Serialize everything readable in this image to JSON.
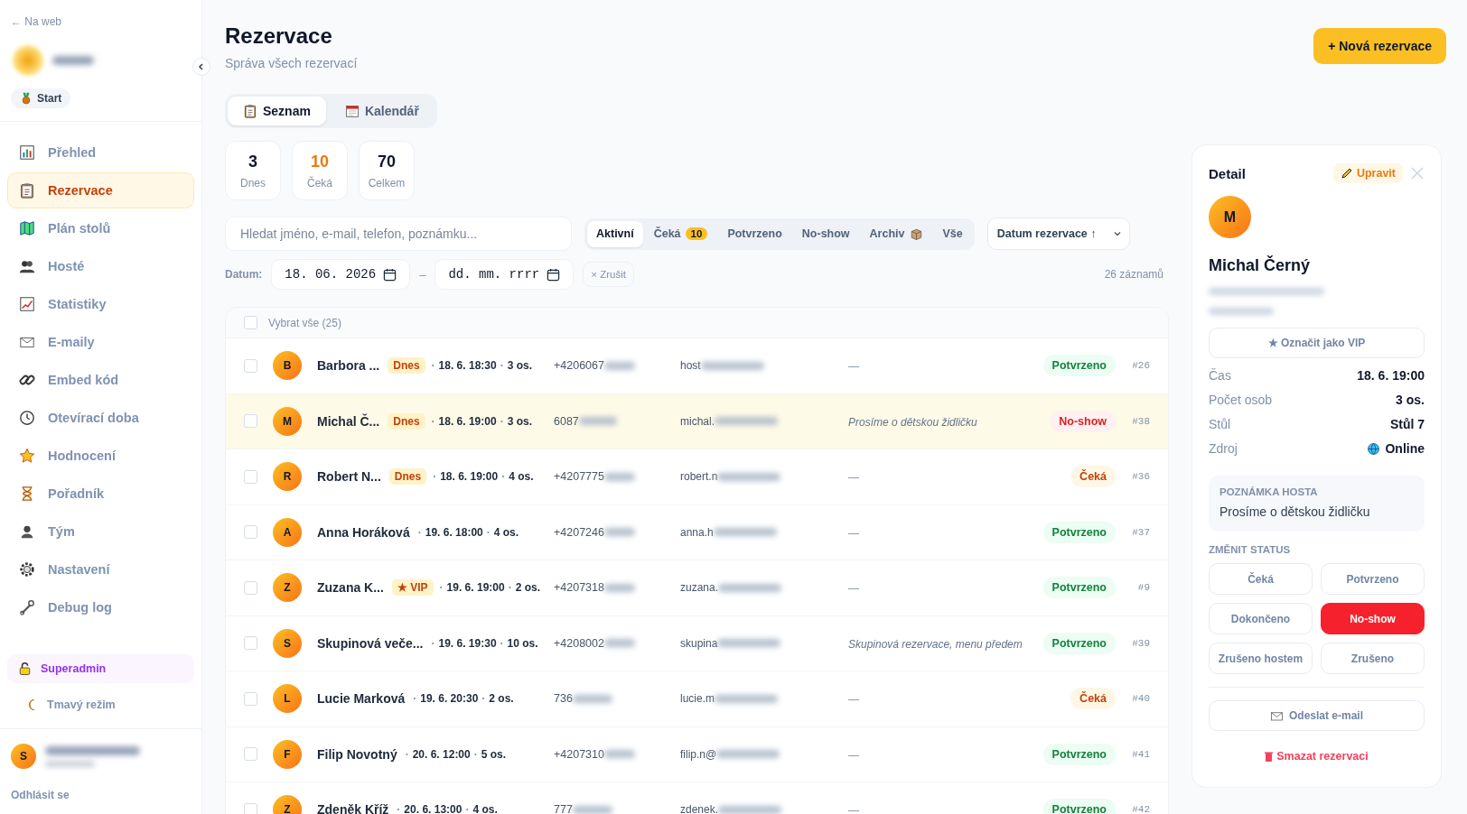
{
  "sidebar": {
    "back_link": "← Na web",
    "start_badge": "Start",
    "nav": [
      {
        "label": "Přehled",
        "selected": false
      },
      {
        "label": "Rezervace",
        "selected": true
      },
      {
        "label": "Plán stolů",
        "selected": false
      },
      {
        "label": "Hosté",
        "selected": false
      },
      {
        "label": "Statistiky",
        "selected": false
      },
      {
        "label": "E-maily",
        "selected": false
      },
      {
        "label": "Embed kód",
        "selected": false
      },
      {
        "label": "Otevírací doba",
        "selected": false
      },
      {
        "label": "Hodnocení",
        "selected": false
      },
      {
        "label": "Pořadník",
        "selected": false
      },
      {
        "label": "Tým",
        "selected": false
      },
      {
        "label": "Nastavení",
        "selected": false
      },
      {
        "label": "Debug log",
        "selected": false
      }
    ],
    "superadmin": "Superadmin",
    "dark_mode": "Tmavý režim",
    "user_initial": "S",
    "logout": "Odhlásit se"
  },
  "page": {
    "title": "Rezervace",
    "subtitle": "Správa všech rezervací",
    "new_button": "+ Nová rezervace"
  },
  "view_tabs": [
    {
      "label": "Seznam",
      "selected": true
    },
    {
      "label": "Kalendář",
      "selected": false
    }
  ],
  "stats": [
    {
      "value": "3",
      "label": "Dnes",
      "highlight": false
    },
    {
      "value": "10",
      "label": "Čeká",
      "highlight": true
    },
    {
      "value": "70",
      "label": "Celkem",
      "highlight": false
    }
  ],
  "search": {
    "placeholder": "Hledat jméno, e-mail, telefon, poznámku..."
  },
  "filters": [
    {
      "label": "Aktivní",
      "selected": true
    },
    {
      "label": "Čeká",
      "count": "10",
      "selected": false
    },
    {
      "label": "Potvrzeno",
      "selected": false
    },
    {
      "label": "No-show",
      "selected": false
    },
    {
      "label": "Archiv",
      "selected": false
    },
    {
      "label": "Vše",
      "selected": false
    }
  ],
  "sort": {
    "label": "Datum rezervace ↑"
  },
  "date_filter": {
    "label": "Datum:",
    "from": "18. 06. 2026",
    "separator": "–",
    "to_placeholder": "dd. mm. rrrr",
    "clear": "× Zrušit"
  },
  "record_count": "26 záznamů",
  "table": {
    "select_all": "Vybrat vše (25)",
    "select_all_checked": false,
    "rows": [
      {
        "checked": false,
        "initial": "B",
        "name": "Barbora ...",
        "tag": "Dnes",
        "sep1": "·",
        "datetime": "18. 6. 18:30",
        "sep2": "·",
        "guests": "3 os.",
        "phone": "+4206067",
        "email": "host",
        "note": "—",
        "status": {
          "kind": "confirmed",
          "label": "Potvrzeno"
        },
        "id": "#26",
        "selected": false
      },
      {
        "checked": false,
        "initial": "M",
        "name": "Michal Č...",
        "tag": "Dnes",
        "sep1": "·",
        "datetime": "18. 6. 19:00",
        "sep2": "·",
        "guests": "3 os.",
        "phone": "6087",
        "email": "michal.",
        "note": "Prosíme o dětskou židličku",
        "status": {
          "kind": "noshow",
          "label": "No-show"
        },
        "id": "#38",
        "selected": true
      },
      {
        "checked": false,
        "initial": "R",
        "name": "Robert N...",
        "tag": "Dnes",
        "sep1": "·",
        "datetime": "18. 6. 19:00",
        "sep2": "·",
        "guests": "4 os.",
        "phone": "+4207775",
        "email": "robert.n",
        "note": "—",
        "status": {
          "kind": "pending",
          "label": "Čeká"
        },
        "id": "#36",
        "selected": false
      },
      {
        "checked": false,
        "initial": "A",
        "name": "Anna Horáková",
        "sep1": "·",
        "datetime": "19. 6. 18:00",
        "sep2": "·",
        "guests": "4 os.",
        "phone": "+4207246",
        "email": "anna.h",
        "note": "—",
        "status": {
          "kind": "confirmed",
          "label": "Potvrzeno"
        },
        "id": "#37",
        "selected": false
      },
      {
        "checked": false,
        "initial": "Z",
        "name": "Zuzana K...",
        "tag": "★ VIP",
        "sep1": "·",
        "datetime": "19. 6. 19:00",
        "sep2": "·",
        "guests": "2 os.",
        "phone": "+4207318",
        "email": "zuzana.",
        "note": "—",
        "status": {
          "kind": "confirmed",
          "label": "Potvrzeno"
        },
        "id": "#9",
        "selected": false
      },
      {
        "checked": false,
        "initial": "S",
        "name": "Skupinová veče...",
        "sep1": "·",
        "datetime": "19. 6. 19:30",
        "sep2": "·",
        "guests": "10 os.",
        "phone": "+4208002",
        "email": "skupina",
        "note": "Skupinová rezervace, menu předem",
        "status": {
          "kind": "confirmed",
          "label": "Potvrzeno"
        },
        "id": "#39",
        "selected": false
      },
      {
        "checked": false,
        "initial": "L",
        "name": "Lucie Marková",
        "sep1": "·",
        "datetime": "19. 6. 20:30",
        "sep2": "·",
        "guests": "2 os.",
        "phone": "736",
        "email": "lucie.m",
        "note": "—",
        "status": {
          "kind": "pending",
          "label": "Čeká"
        },
        "id": "#40",
        "selected": false
      },
      {
        "checked": false,
        "initial": "F",
        "name": "Filip Novotný",
        "sep1": "·",
        "datetime": "20. 6. 12:00",
        "sep2": "·",
        "guests": "5 os.",
        "phone": "+4207310",
        "email": "filip.n@",
        "note": "—",
        "status": {
          "kind": "confirmed",
          "label": "Potvrzeno"
        },
        "id": "#41",
        "selected": false
      },
      {
        "checked": false,
        "initial": "Z",
        "name": "Zdeněk Kříž",
        "sep1": "·",
        "datetime": "20. 6. 13:00",
        "sep2": "·",
        "guests": "4 os.",
        "phone": "777",
        "email": "zdenek.",
        "note": "—",
        "status": {
          "kind": "confirmed",
          "label": "Potvrzeno"
        },
        "id": "#42",
        "selected": false
      }
    ]
  },
  "detail": {
    "title": "Detail",
    "edit_button": "Upravit",
    "initial": "M",
    "name": "Michal Černý",
    "vip_button": "★ Označit jako VIP",
    "fields": [
      {
        "label": "Čas",
        "value": "18. 6. 19:00"
      },
      {
        "label": "Počet osob",
        "value": "3 os."
      },
      {
        "label": "Stůl",
        "value": "Stůl 7"
      },
      {
        "label": "Zdroj",
        "value": "Online"
      }
    ],
    "note_title": "POZNÁMKA HOSTA",
    "note": "Prosíme o dětskou židličku",
    "status_title": "ZMĚNIT STATUS",
    "status_buttons": [
      {
        "label": "Čeká",
        "selected": false
      },
      {
        "label": "Potvrzeno",
        "selected": false
      },
      {
        "label": "Dokončeno",
        "selected": false
      },
      {
        "label": "No-show",
        "selected": true
      },
      {
        "label": "Zrušeno hostem",
        "selected": false
      },
      {
        "label": "Zrušeno",
        "selected": false
      }
    ],
    "email_button": "Odeslat e-mail",
    "delete_button": "Smazat rezervaci"
  }
}
